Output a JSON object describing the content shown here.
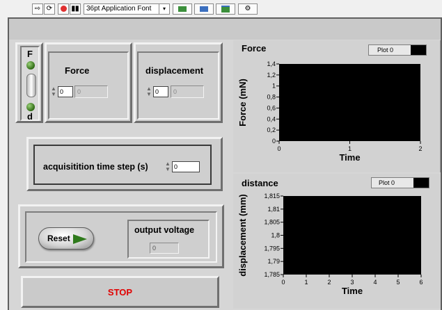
{
  "toolbar": {
    "font_select": "36pt Application Font",
    "font_arrow": "▾"
  },
  "switch": {
    "top_label": "F",
    "bottom_label": "d"
  },
  "force_control": {
    "label": "Force",
    "value": "0",
    "indicator": "0"
  },
  "displacement_control": {
    "label": "displacement",
    "value": "0",
    "indicator": "0"
  },
  "acquisition": {
    "label": "acquisitition time step (s)",
    "value": "0"
  },
  "reset": {
    "label": "Reset"
  },
  "output_voltage": {
    "label": "output voltage",
    "value": "0"
  },
  "stop": {
    "label": "STOP",
    "color": "#e00000"
  },
  "charts": {
    "force": {
      "title": "Force",
      "plot_legend": "Plot 0",
      "ylabel": "Force (mN)",
      "xlabel": "Time",
      "yticks": [
        "1,4",
        "1,2",
        "1",
        "0,8",
        "0,6",
        "0,4",
        "0,2",
        "0"
      ],
      "xticks": [
        "0",
        "1",
        "2"
      ]
    },
    "distance": {
      "title": "distance",
      "plot_legend": "Plot 0",
      "ylabel": "displacement (mm)",
      "xlabel": "Time",
      "yticks": [
        "1,815",
        "1,81",
        "1,805",
        "1,8",
        "1,795",
        "1,79",
        "1,785"
      ],
      "xticks": [
        "0",
        "1",
        "2",
        "3",
        "4",
        "5",
        "6"
      ]
    }
  },
  "chart_data": [
    {
      "type": "line",
      "title": "Force",
      "xlabel": "Time",
      "ylabel": "Force (mN)",
      "xlim": [
        0,
        2
      ],
      "ylim": [
        0,
        1.4
      ],
      "series": [
        {
          "name": "Plot 0",
          "x": [],
          "y": []
        }
      ],
      "grid": false,
      "legend": "top-right"
    },
    {
      "type": "line",
      "title": "distance",
      "xlabel": "Time",
      "ylabel": "displacement (mm)",
      "xlim": [
        0,
        6
      ],
      "ylim": [
        1.785,
        1.815
      ],
      "series": [
        {
          "name": "Plot 0",
          "x": [],
          "y": []
        }
      ],
      "grid": false,
      "legend": "top-right"
    }
  ]
}
